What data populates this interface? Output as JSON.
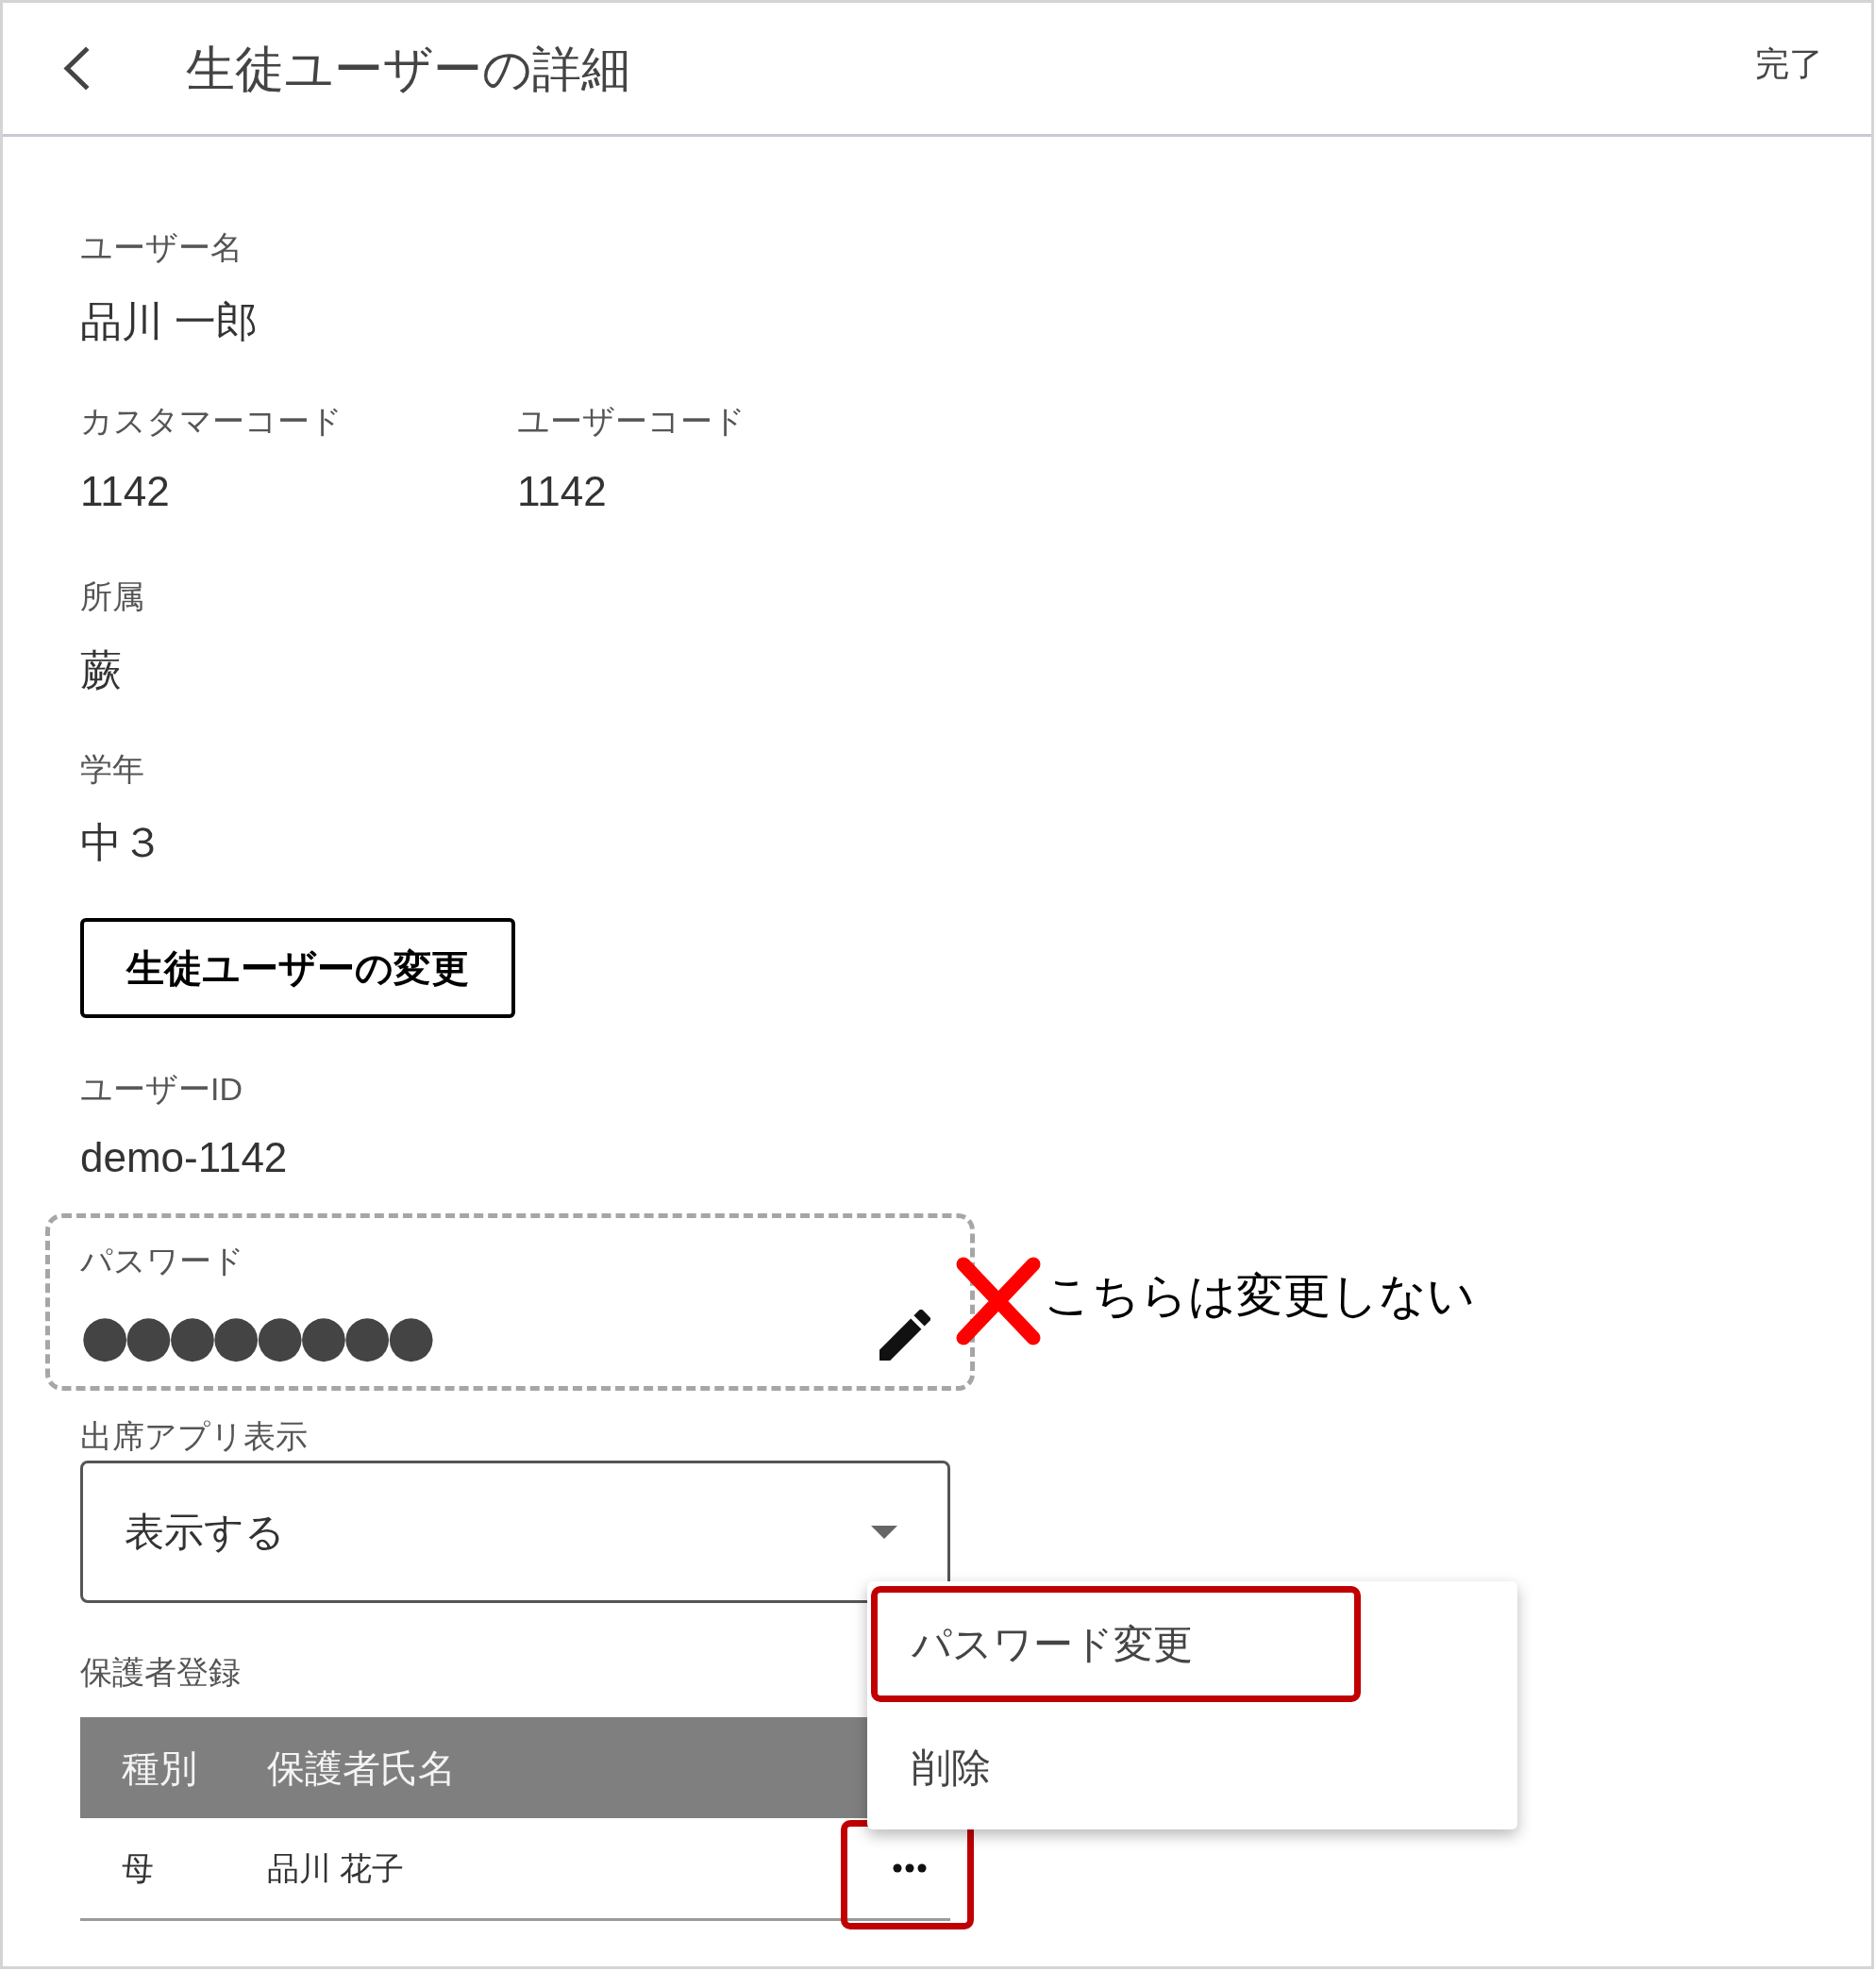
{
  "header": {
    "title": "生徒ユーザーの詳細",
    "done_button": "完了"
  },
  "user_name": {
    "label": "ユーザー名",
    "value": "品川 一郎"
  },
  "codes": [
    {
      "label": "カスタマーコード",
      "value": "1142"
    },
    {
      "label": "ユーザーコード",
      "value": "1142"
    }
  ],
  "affiliation": {
    "label": "所属",
    "value": "蕨"
  },
  "grade": {
    "label": "学年",
    "value": "中３"
  },
  "edit_student_button": "生徒ユーザーの変更",
  "user_id": {
    "label": "ユーザーID",
    "value": "demo-1142"
  },
  "password": {
    "label": "パスワード",
    "value": "●●●●●●●●",
    "note": "こちらは変更しない"
  },
  "attendance_app_display": {
    "label": "出席アプリ表示",
    "value": "表示する"
  },
  "guardians": {
    "label": "保護者登録",
    "columns": [
      "種別",
      "保護者氏名"
    ],
    "rows": [
      {
        "cells": [
          "母",
          "品川 花子"
        ],
        "highlighted": true
      }
    ]
  },
  "context_menu": {
    "items": [
      {
        "label": "パスワード変更",
        "highlighted": true
      },
      {
        "label": "削除",
        "highlighted": false
      }
    ]
  }
}
